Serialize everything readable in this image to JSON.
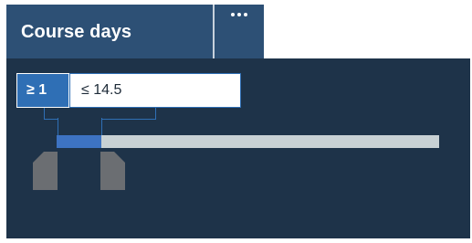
{
  "header": {
    "title": "Course days",
    "more_icon": "ellipsis-icon"
  },
  "range_filter": {
    "min_label": "≥ 1",
    "max_label": "≤ 14.5",
    "min_value": 1,
    "max_value": 14.5,
    "selected_fraction": 0.12
  },
  "colors": {
    "header_bg": "#2d5075",
    "panel_bg": "#1e3349",
    "accent": "#3d73c2",
    "track": "#c8d1d4",
    "handle": "#6b6e72"
  }
}
